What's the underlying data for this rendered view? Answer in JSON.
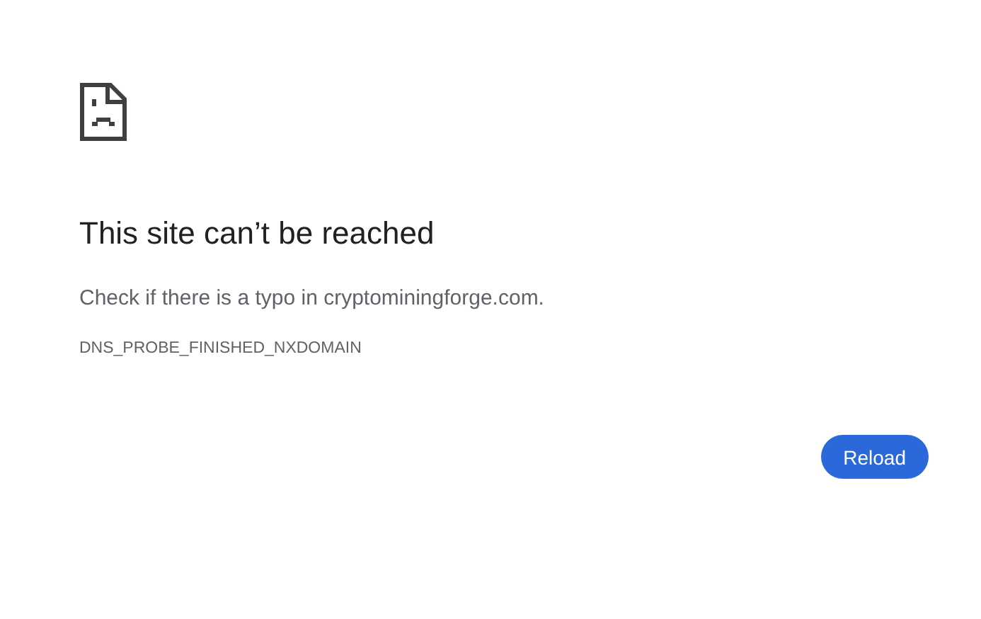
{
  "error": {
    "title": "This site can’t be reached",
    "message": "Check if there is a typo in cryptominingforge.com.",
    "code": "DNS_PROBE_FINISHED_NXDOMAIN"
  },
  "buttons": [
    {
      "label": "Reload",
      "kind": "primary"
    }
  ]
}
